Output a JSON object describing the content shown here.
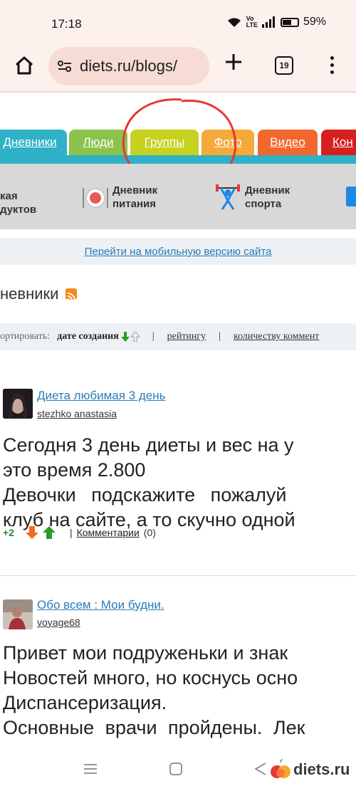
{
  "status": {
    "time": "17:18",
    "battery_percent": "59%"
  },
  "browser": {
    "url": "diets.ru/blogs/",
    "tab_count": "19"
  },
  "nav_tabs": [
    {
      "label": "Дневники",
      "color": "#2fb1c8"
    },
    {
      "label": "Люди",
      "color": "#8bc34a"
    },
    {
      "label": "Группы",
      "color": "#c6d21f"
    },
    {
      "label": "Фото",
      "color": "#f5a93b"
    },
    {
      "label": "Видео",
      "color": "#f2672e"
    },
    {
      "label": "Кон",
      "color": "#d81f1f"
    }
  ],
  "tools": [
    {
      "line1": "кая",
      "line2": "дуктов"
    },
    {
      "line1": "Дневник",
      "line2": "питания",
      "icon": "plate-icon"
    },
    {
      "line1": "Дневник",
      "line2": "спорта",
      "icon": "weightlifter-icon"
    }
  ],
  "mobile_link": "Перейти на мобильную версию сайта",
  "section_title": "невники",
  "sort": {
    "label": "ортировать:",
    "active": "дате создания",
    "options": [
      "рейтингу",
      "количеству коммент"
    ]
  },
  "posts": [
    {
      "title": "Диета любимая 3 день",
      "author": "stezhko anastasia",
      "lines": [
        "Сегодня 3 день диеты и вес на у",
        "это время 2.800",
        "Девочки подскажите пожалуй",
        "клуб на сайте, а то скучно одной"
      ],
      "rating": "+2",
      "comments_label": "Комментарии",
      "comments_count": "(0)"
    },
    {
      "title": "Обо всем : Мои будни.",
      "author": "voyage68",
      "lines": [
        "Привет мои подруженьки и знак",
        "Новостей много, но коснусь осно",
        "Диспансеризация.",
        "Основные врачи пройдены. Лек"
      ]
    }
  ],
  "watermark": "diets.ru"
}
